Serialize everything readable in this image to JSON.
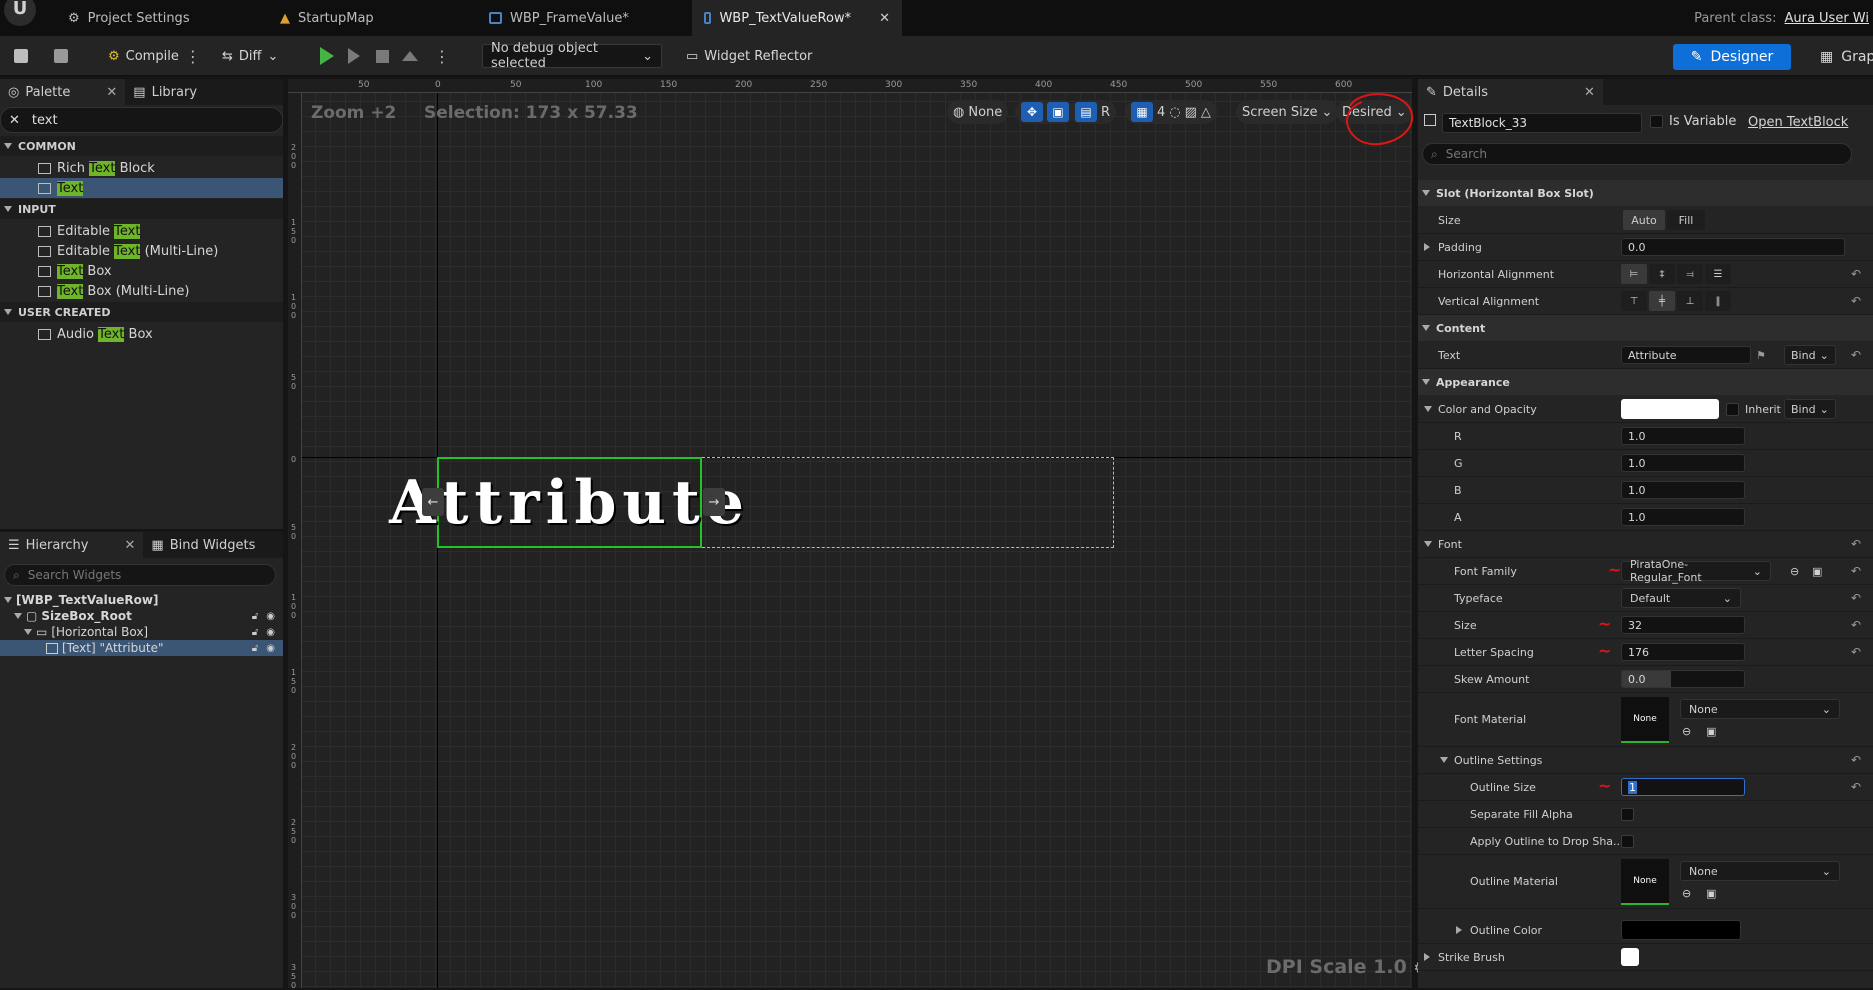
{
  "app": {
    "logo": "U"
  },
  "tabs": [
    {
      "label": "Project Settings",
      "icon": "gear-icon"
    },
    {
      "label": "StartupMap",
      "icon": "map-icon"
    },
    {
      "label": "WBP_FrameValue*",
      "icon": "widget-blueprint-icon"
    },
    {
      "label": "WBP_TextValueRow*",
      "icon": "widget-blueprint-icon",
      "active": true
    }
  ],
  "tab_close": "✕",
  "parent_class": {
    "label": "Parent class:",
    "value": "Aura User Wi"
  },
  "toolbar": {
    "compile": "Compile",
    "diff": "Diff",
    "debug_object": "No debug object selected",
    "widget_reflector": "Widget Reflector",
    "designer": "Designer",
    "graph": "Grap"
  },
  "palette": {
    "tab_palette": "Palette",
    "tab_library": "Library",
    "search_value": "text",
    "categories": [
      {
        "name": "COMMON",
        "items": [
          {
            "pre": "Rich ",
            "hl": "Text",
            "post": " Block"
          },
          {
            "pre": "",
            "hl": "Text",
            "post": "",
            "selected": true
          }
        ]
      },
      {
        "name": "INPUT",
        "items": [
          {
            "pre": "Editable ",
            "hl": "Text",
            "post": ""
          },
          {
            "pre": "Editable ",
            "hl": "Text",
            "post": " (Multi-Line)"
          },
          {
            "pre": "",
            "hl": "Text",
            "post": " Box"
          },
          {
            "pre": "",
            "hl": "Text",
            "post": " Box (Multi-Line)"
          }
        ]
      },
      {
        "name": "USER CREATED",
        "items": [
          {
            "pre": "Audio ",
            "hl": "Text",
            "post": " Box"
          }
        ]
      }
    ]
  },
  "hierarchy": {
    "tab_hierarchy": "Hierarchy",
    "tab_bind": "Bind Widgets",
    "search_placeholder": "Search Widgets",
    "rows": [
      {
        "label": "[WBP_TextValueRow]",
        "indent": 0
      },
      {
        "label": "SizeBox_Root",
        "indent": 1
      },
      {
        "label": "[Horizontal Box]",
        "indent": 2
      },
      {
        "label": "[Text] \"Attribute\"",
        "indent": 3,
        "selected": true
      }
    ]
  },
  "canvas": {
    "zoom": "Zoom +2",
    "selection": "Selection: 173 x 57.33",
    "dpi": "DPI Scale 1.0",
    "widget_text": "Attribute",
    "tools": {
      "none": "None",
      "r": "R",
      "grid": "4",
      "screen_size": "Screen Size",
      "desired": "Desired"
    },
    "ruler_top": [
      "50",
      "0",
      "50",
      "100",
      "150",
      "200",
      "250",
      "300",
      "350",
      "400",
      "450",
      "500",
      "550",
      "600"
    ],
    "ruler_left": [
      "200",
      "150",
      "100",
      "50",
      "0",
      "50",
      "100",
      "150",
      "200",
      "250",
      "300",
      "350"
    ]
  },
  "details": {
    "tab": "Details",
    "widget_name": "TextBlock_33",
    "is_variable": "Is Variable",
    "open_link": "Open TextBlock",
    "search_placeholder": "Search",
    "slot_section": "Slot (Horizontal Box Slot)",
    "size": {
      "label": "Size",
      "auto": "Auto",
      "fill": "Fill"
    },
    "padding": {
      "label": "Padding",
      "value": "0.0"
    },
    "h_align": "Horizontal Alignment",
    "v_align": "Vertical Alignment",
    "content_section": "Content",
    "text": {
      "label": "Text",
      "value": "Attribute",
      "bind": "Bind"
    },
    "appearance_section": "Appearance",
    "color_opacity": {
      "label": "Color and Opacity",
      "inherit": "Inherit",
      "bind": "Bind",
      "color": "#ffffff"
    },
    "r": {
      "label": "R",
      "value": "1.0"
    },
    "g": {
      "label": "G",
      "value": "1.0"
    },
    "b": {
      "label": "B",
      "value": "1.0"
    },
    "a": {
      "label": "A",
      "value": "1.0"
    },
    "font_section": "Font",
    "font_family": {
      "label": "Font Family",
      "value": "PirataOne-Regular_Font"
    },
    "typeface": {
      "label": "Typeface",
      "value": "Default"
    },
    "font_size": {
      "label": "Size",
      "value": "32"
    },
    "letter_spacing": {
      "label": "Letter Spacing",
      "value": "176"
    },
    "skew": {
      "label": "Skew Amount",
      "value": "0.0"
    },
    "font_material": {
      "label": "Font Material",
      "thumb": "None",
      "value": "None"
    },
    "outline_settings": "Outline Settings",
    "outline_size": {
      "label": "Outline Size",
      "value": "1"
    },
    "separate_fill_alpha": "Separate Fill Alpha",
    "apply_outline": "Apply Outline to Drop Sha...",
    "outline_material": {
      "label": "Outline Material",
      "thumb": "None",
      "value": "None"
    },
    "outline_color": {
      "label": "Outline Color",
      "color": "#000000"
    },
    "strike_brush": {
      "label": "Strike Brush",
      "color": "#ffffff"
    }
  },
  "colors": {
    "accent": "#0e6fd8",
    "selection": "#3b5574",
    "highlight": "#6fb52a",
    "widget_border": "#22c322",
    "annotation": "#e01515"
  }
}
